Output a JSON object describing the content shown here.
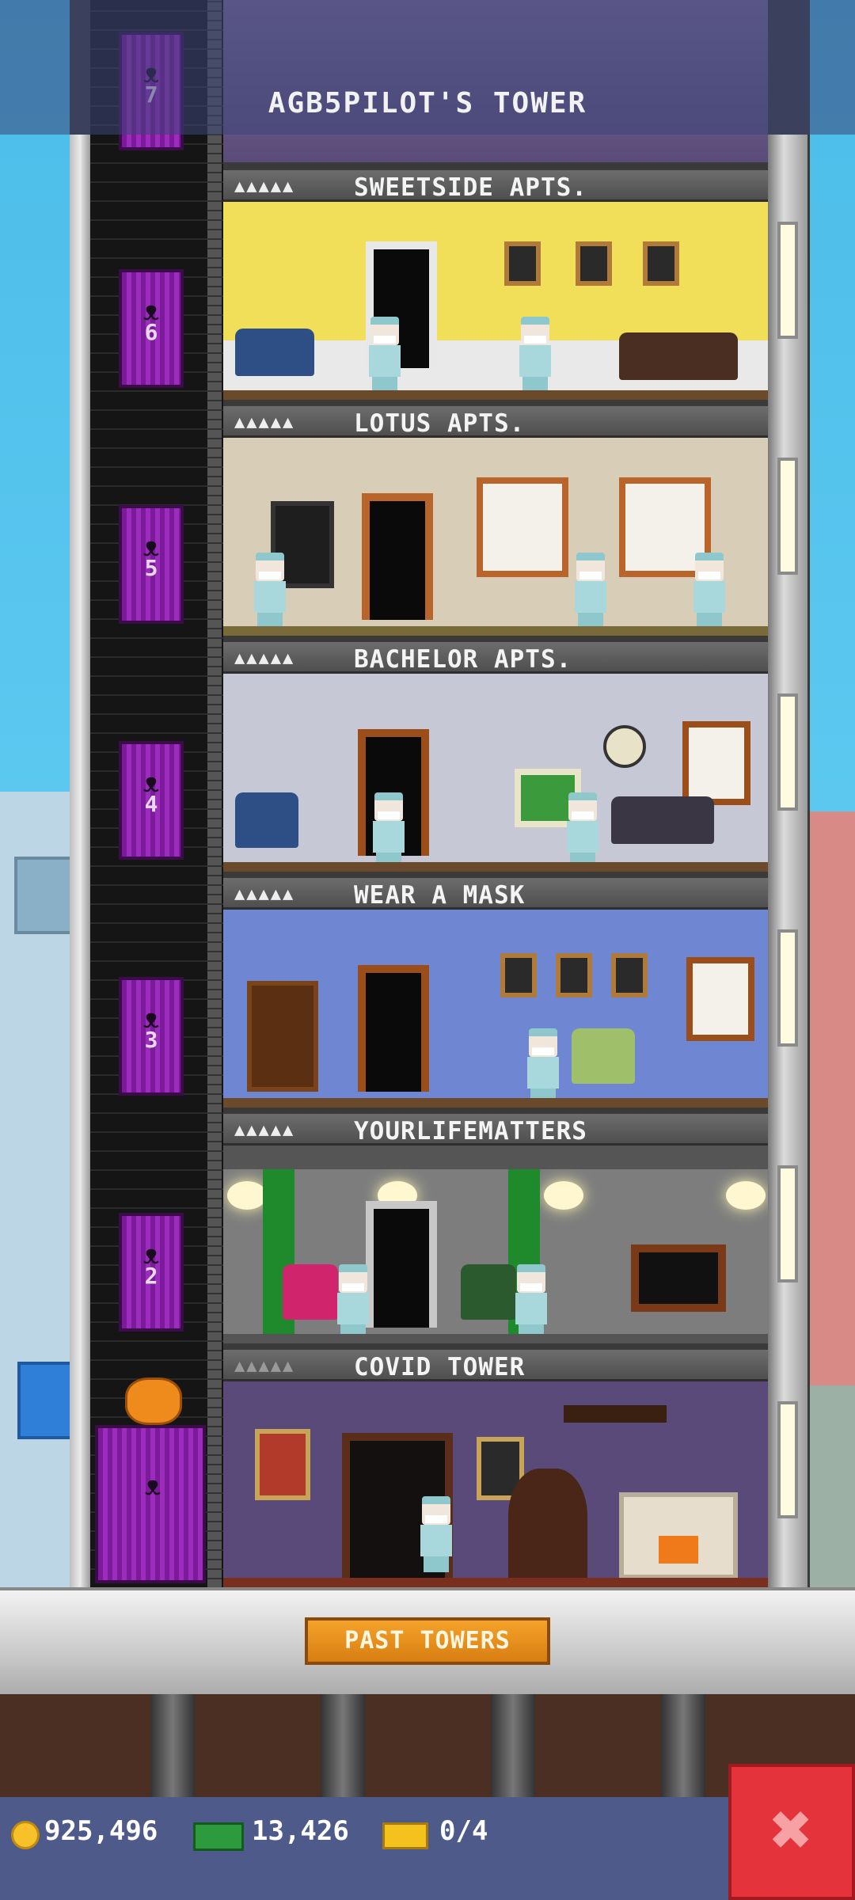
{
  "header": {
    "title": "AGB5PILOT'S TOWER"
  },
  "elevator": {
    "floor_numbers": [
      "7",
      "6",
      "5",
      "4",
      "3",
      "2"
    ]
  },
  "floors": [
    {
      "name": "SWEETSIDE APTS.",
      "stars": "▲▲▲▲▲"
    },
    {
      "name": "LOTUS APTS.",
      "stars": "▲▲▲▲▲"
    },
    {
      "name": "BACHELOR APTS.",
      "stars": "▲▲▲▲▲"
    },
    {
      "name": "WEAR A MASK",
      "stars": "▲▲▲▲▲"
    },
    {
      "name": "YOURLIFEMATTERS",
      "stars": "▲▲▲▲▲"
    },
    {
      "name": "COVID TOWER",
      "stars": "▲▲▲▲▲"
    }
  ],
  "base": {
    "past_towers_label": "PAST TOWERS"
  },
  "status": {
    "coins": "925,496",
    "bux": "13,426",
    "tickets": "0/4"
  },
  "icons": {
    "coin": "coin-icon",
    "cash": "tower-bux-icon",
    "ticket": "golden-ticket-icon",
    "close": "close-icon"
  },
  "colors": {
    "elevator": "#9c2cbc",
    "accent_button": "#f4a32a",
    "close_button": "#e5333b"
  }
}
